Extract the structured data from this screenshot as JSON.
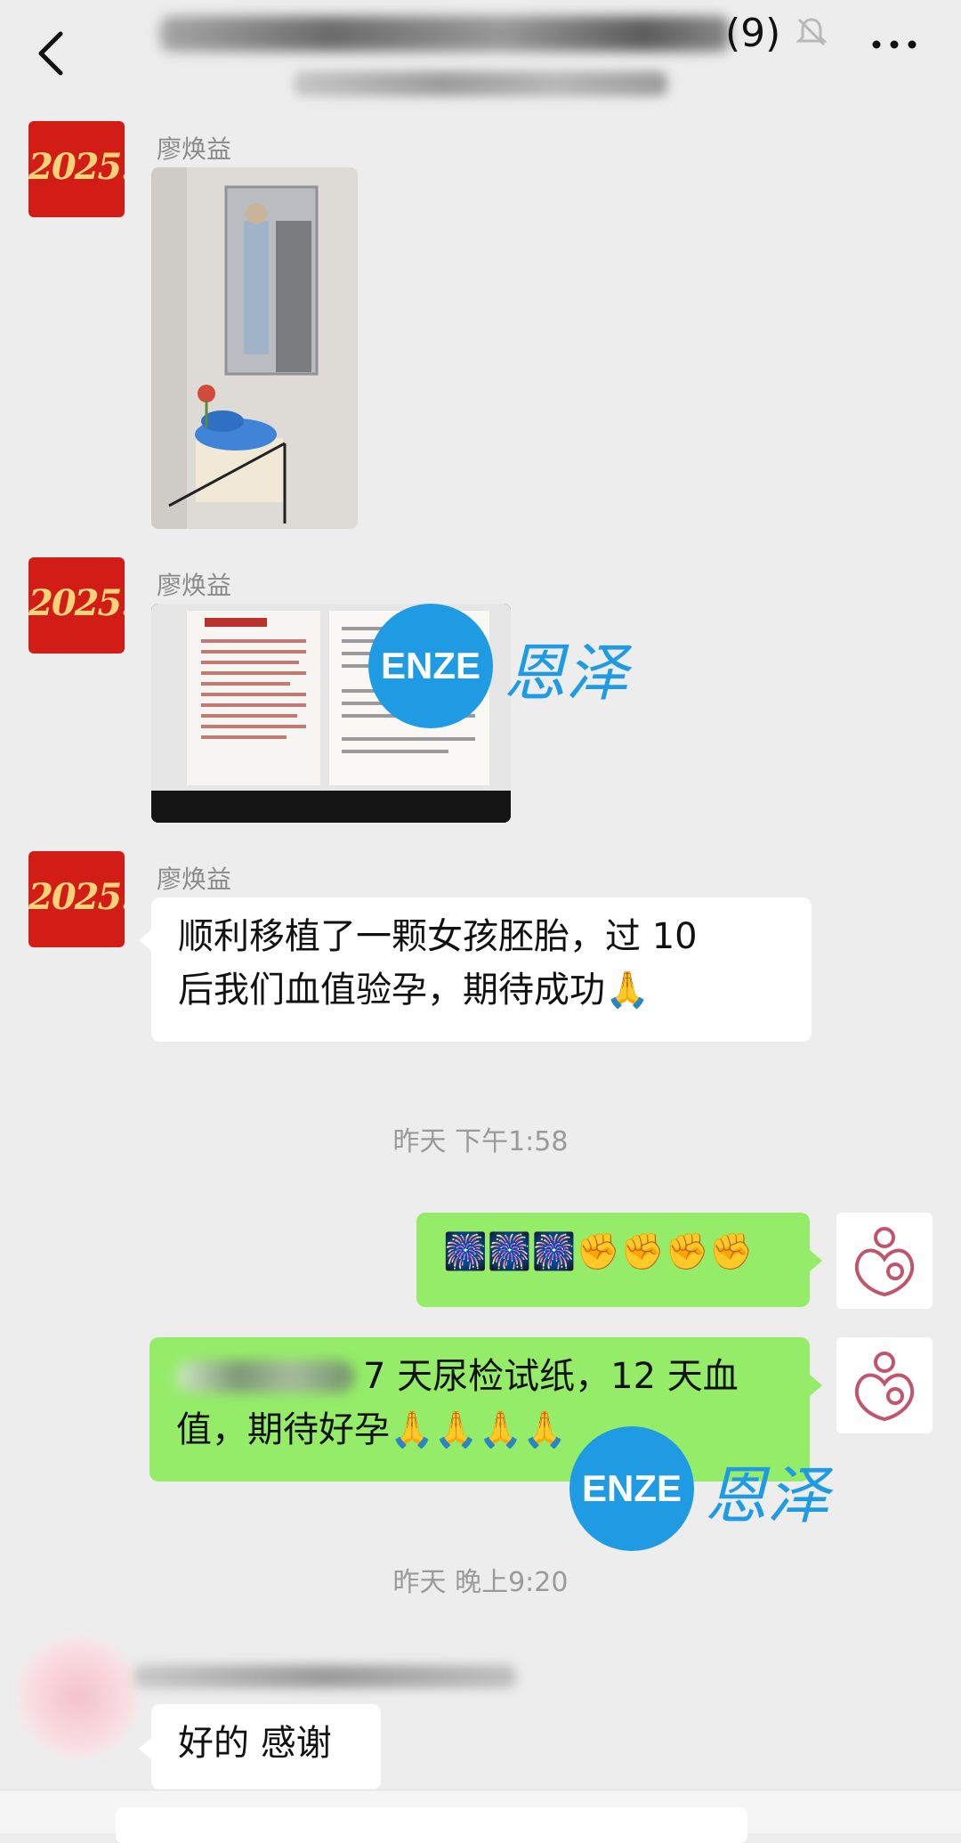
{
  "header": {
    "member_count": "(9)",
    "icons": {
      "back": "back-arrow-icon",
      "mute": "bell-muted-icon",
      "more": "more-icon"
    }
  },
  "messages": [
    {
      "type": "image",
      "sender": "廖焕益",
      "avatar_text": "2025."
    },
    {
      "type": "image",
      "sender": "廖焕益",
      "avatar_text": "2025."
    },
    {
      "type": "text",
      "sender": "廖焕益",
      "avatar_text": "2025.",
      "line1": "顺利移植了一颗女孩胚胎，过 10",
      "line2": "后我们血值验孕，期待成功🙏"
    },
    {
      "type": "timestamp",
      "text": "昨天 下午1:58"
    },
    {
      "type": "text-self",
      "text": "🎆🎆🎆✊✊✊✊"
    },
    {
      "type": "text-self",
      "line1_tail": "7 天尿检试纸，12 天血",
      "line2": "值，期待好孕🙏🙏🙏🙏"
    },
    {
      "type": "timestamp",
      "text": "昨天 晚上9:20"
    },
    {
      "type": "text",
      "text": "好的 感谢"
    }
  ],
  "watermark": {
    "circle": "ENZE",
    "text": "恩泽"
  },
  "colors": {
    "background": "#ededed",
    "self_bubble": "#95ec69",
    "other_bubble": "#ffffff",
    "avatar_red": "#d11d16",
    "watermark": "#1e9be3"
  }
}
